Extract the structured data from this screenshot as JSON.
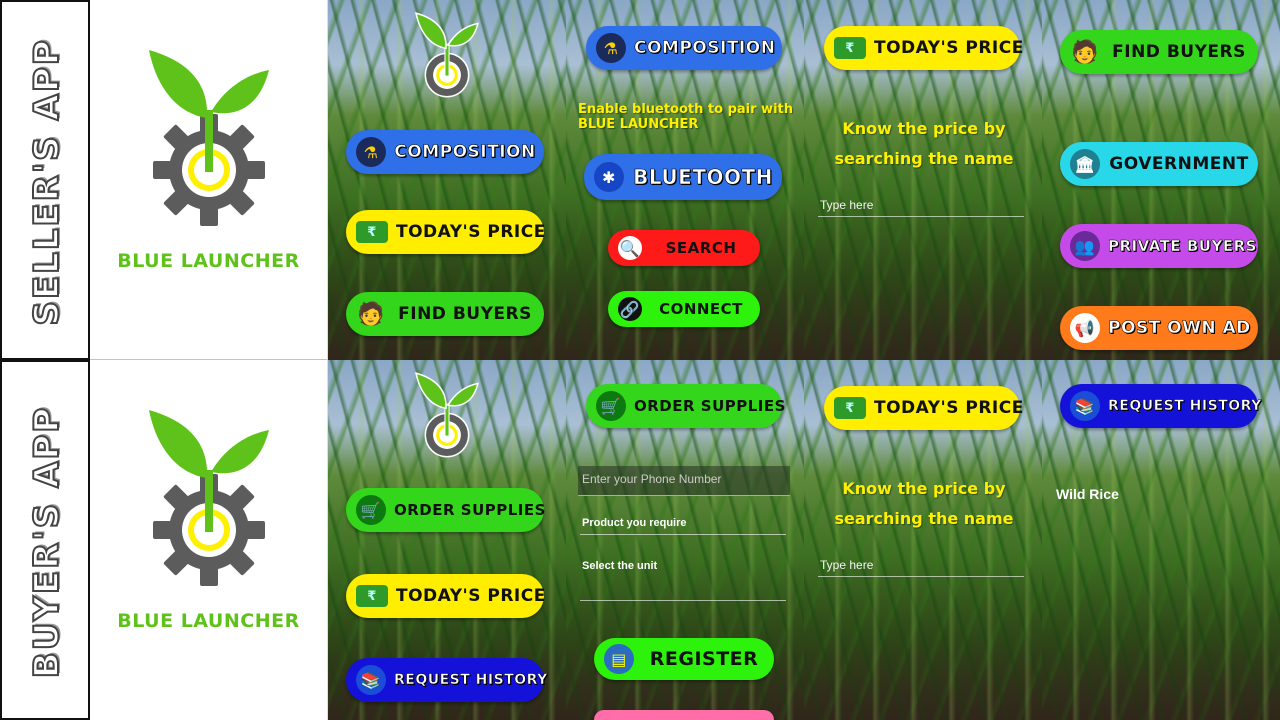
{
  "labels": {
    "seller": "SELLER'S APP",
    "buyer": "BUYER'S APP"
  },
  "brand": {
    "name": "BLUE LAUNCHER"
  },
  "seller": {
    "home": {
      "composition": "COMPOSITION",
      "todays_price": "TODAY'S PRICE",
      "find_buyers": "FIND BUYERS"
    },
    "composition": {
      "title": "COMPOSITION",
      "message": "Enable bluetooth to pair with BLUE LAUNCHER",
      "bluetooth": "BLUETOOTH",
      "search": "SEARCH",
      "connect": "CONNECT"
    },
    "price": {
      "title": "TODAY'S PRICE",
      "message": "Know the price by searching the name",
      "placeholder": "Type here"
    },
    "buyers": {
      "find_buyers": "FIND BUYERS",
      "government": "GOVERNMENT",
      "private_buyers": "PRIVATE BUYERS",
      "post_own_ad": "POST OWN AD"
    }
  },
  "buyer": {
    "home": {
      "order_supplies": "ORDER SUPPLIES",
      "todays_price": "TODAY'S PRICE",
      "request_history": "REQUEST HISTORY"
    },
    "order": {
      "title": "ORDER SUPPLIES",
      "phone_placeholder": "Enter your Phone Number",
      "product_label": "Product you require",
      "unit_label": "Select the unit",
      "register": "REGISTER"
    },
    "price": {
      "title": "TODAY'S PRICE",
      "message": "Know the price by searching the name",
      "placeholder": "Type here"
    },
    "history": {
      "title": "REQUEST HISTORY",
      "item": "Wild Rice"
    }
  },
  "colors": {
    "brand_green": "#5ec21a",
    "gear_gray": "#5c5c5c",
    "ring_yellow": "#ffef00"
  },
  "icons": [
    "composition-icon",
    "money-icon",
    "person-icon",
    "bluetooth-icon",
    "search-icon",
    "link-icon",
    "bank-icon",
    "people-icon",
    "megaphone-icon",
    "cart-icon",
    "files-icon",
    "register-icon"
  ]
}
